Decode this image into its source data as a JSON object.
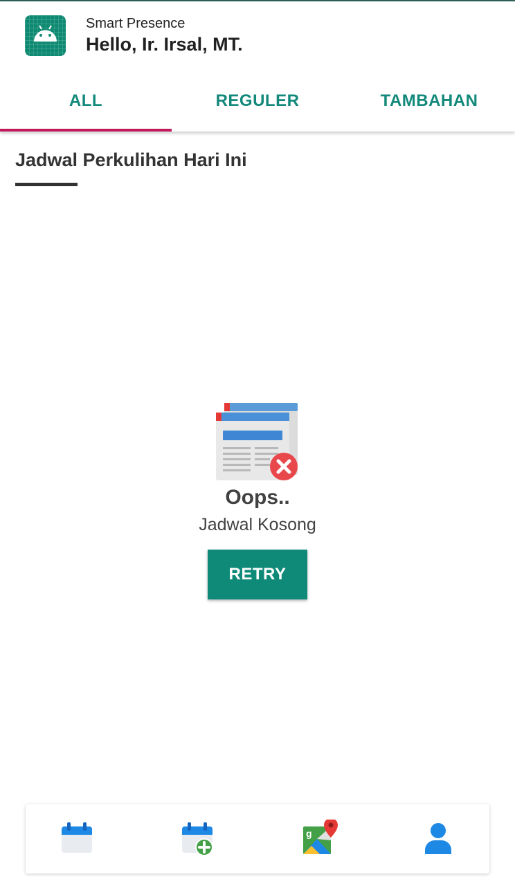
{
  "header": {
    "app_name": "Smart Presence",
    "greeting": "Hello, Ir. Irsal, MT.",
    "icon": "android-icon"
  },
  "tabs": [
    {
      "label": "ALL",
      "active": true
    },
    {
      "label": "REGULER",
      "active": false
    },
    {
      "label": "TAMBAHAN",
      "active": false
    }
  ],
  "section": {
    "title": "Jadwal Perkulihan Hari Ini"
  },
  "empty_state": {
    "icon": "empty-schedule-icon",
    "title": "Oops..",
    "message": "Jadwal Kosong",
    "button_label": "RETRY"
  },
  "bottom_nav": [
    {
      "icon": "calendar-icon"
    },
    {
      "icon": "calendar-add-icon"
    },
    {
      "icon": "map-icon"
    },
    {
      "icon": "profile-icon"
    }
  ],
  "colors": {
    "primary": "#0f8a78",
    "tab_text": "#12897a",
    "tab_indicator": "#c2185b",
    "nav_blue": "#1e88e5"
  }
}
